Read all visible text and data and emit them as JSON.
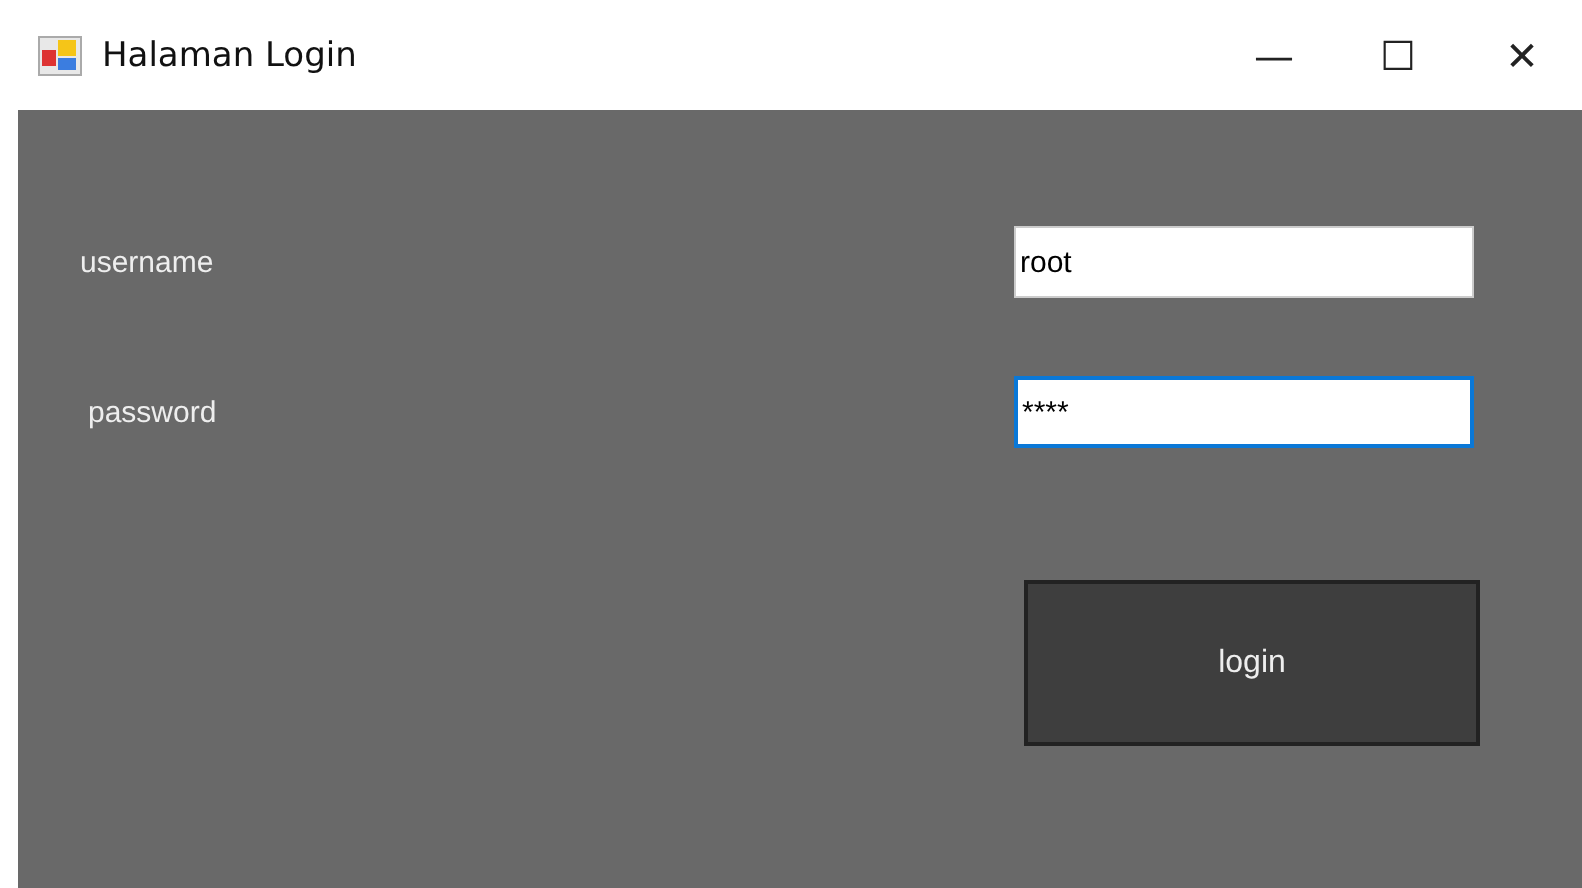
{
  "window": {
    "title": "Halaman Login",
    "controls": [
      "—",
      "☐",
      "✕"
    ]
  },
  "fields": [
    {
      "label": "username",
      "value": "root",
      "focused": false
    },
    {
      "label": "password",
      "value": "****",
      "focused": true
    }
  ],
  "button": {
    "label": "login"
  }
}
